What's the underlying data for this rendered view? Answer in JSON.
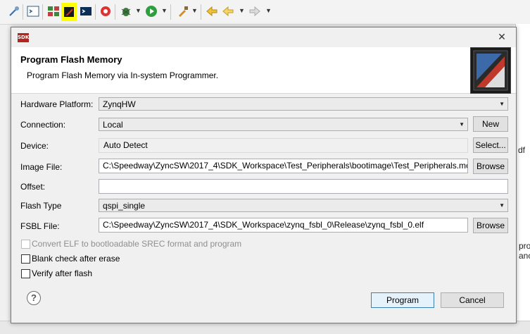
{
  "ide": {
    "toolbar_icons": [
      "pin-icon",
      "terminal-icon",
      "grid-icon",
      "program-flash-icon",
      "console-icon",
      "xilinx-icon",
      "debug-icon",
      "run-icon",
      "tools-icon",
      "back-icon",
      "forward-icon"
    ],
    "highlight_color": "#ffff00",
    "bg_text_1": "df",
    "bg_text_2": "pro",
    "bg_text_3": "anc"
  },
  "dialog": {
    "title_icon_text": "SDK",
    "close_label": "✕",
    "banner_title": "Program Flash Memory",
    "banner_desc": "Program Flash Memory via In-system Programmer.",
    "fields": {
      "hardware_platform": {
        "label": "Hardware Platform:",
        "value": "ZynqHW"
      },
      "connection": {
        "label": "Connection:",
        "value": "Local",
        "button": "New"
      },
      "device": {
        "label": "Device:",
        "value": "Auto Detect",
        "button": "Select..."
      },
      "image_file": {
        "label": "Image File:",
        "value": "C:\\Speedway\\ZyncSW\\2017_4\\SDK_Workspace\\Test_Peripherals\\bootimage\\Test_Peripherals.mcs",
        "button": "Browse"
      },
      "offset": {
        "label": "Offset:",
        "value": ""
      },
      "flash_type": {
        "label": "Flash Type",
        "value": "qspi_single"
      },
      "fsbl_file": {
        "label": "FSBL File:",
        "value": "C:\\Speedway\\ZyncSW\\2017_4\\SDK_Workspace\\zynq_fsbl_0\\Release\\zynq_fsbl_0.elf",
        "button": "Browse"
      }
    },
    "checks": {
      "convert_elf": {
        "label": "Convert ELF to bootloadable SREC format and program",
        "checked": false,
        "enabled": false
      },
      "blank_check": {
        "label": "Blank check after erase",
        "checked": false,
        "enabled": true
      },
      "verify": {
        "label": "Verify after flash",
        "checked": false,
        "enabled": true
      }
    },
    "help_label": "?",
    "program_label": "Program",
    "cancel_label": "Cancel"
  }
}
